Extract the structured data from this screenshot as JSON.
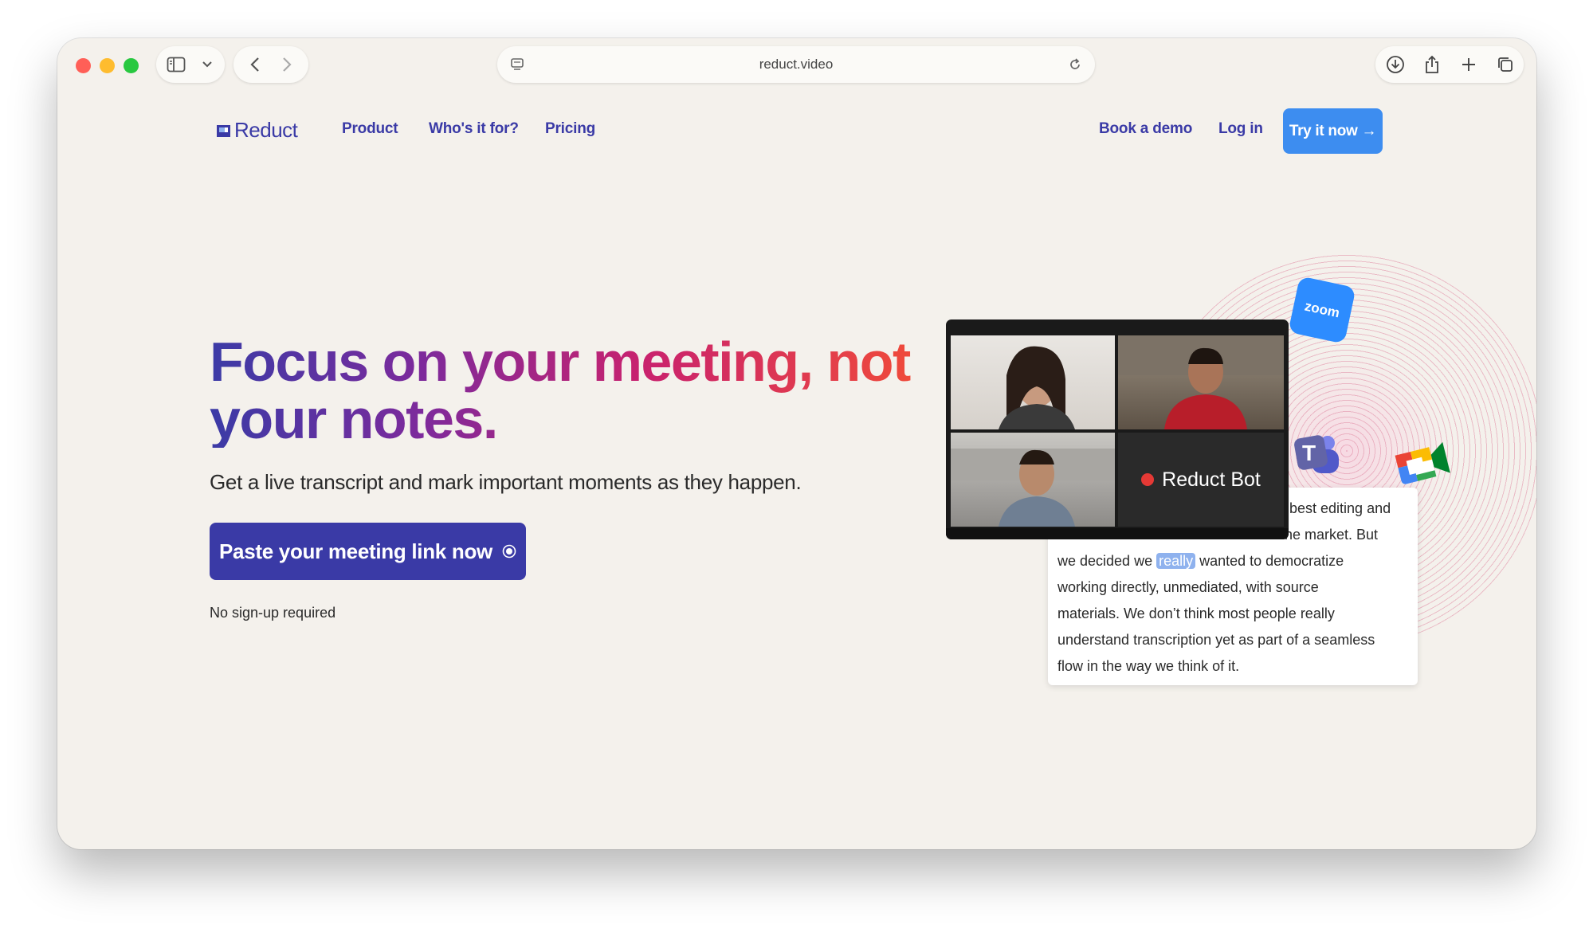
{
  "browser": {
    "url": "reduct.video",
    "icons": [
      "sidebar-icon",
      "chevron-down-icon",
      "back-icon",
      "forward-icon",
      "page-icon",
      "reload-icon",
      "download-icon",
      "share-icon",
      "new-tab-icon",
      "tabs-icon"
    ]
  },
  "nav": {
    "logo": "Reduct",
    "product": "Product",
    "who": "Who's it for?",
    "pricing": "Pricing",
    "book_demo": "Book a demo",
    "log_in": "Log in",
    "try_now": "Try it now →"
  },
  "hero": {
    "headline": "Focus on your meeting, not your notes.",
    "subhead": "Get a live transcript and mark important moments as they happen.",
    "cta": "Paste your meeting link now",
    "note": "No sign-up required"
  },
  "video_call": {
    "bot_label": "Reduct Bot",
    "zoom_label": "zoom"
  },
  "transcript": {
    "line1": "best editing and",
    "line2": "he market. But",
    "line3_before": "we decided we ",
    "line3_highlight": "really",
    "line3_after": " wanted to democratize",
    "line4": "working directly, unmediated, with source",
    "line5": "materials. We don’t think most people really",
    "line6": "understand transcription yet as part of a seamless",
    "line7": "flow in the way we think of it."
  },
  "colors": {
    "brand": "#3a3aa6",
    "accent_button": "#3d8df0",
    "background": "#f4f1ec",
    "highlight": "#8fb2ee"
  }
}
